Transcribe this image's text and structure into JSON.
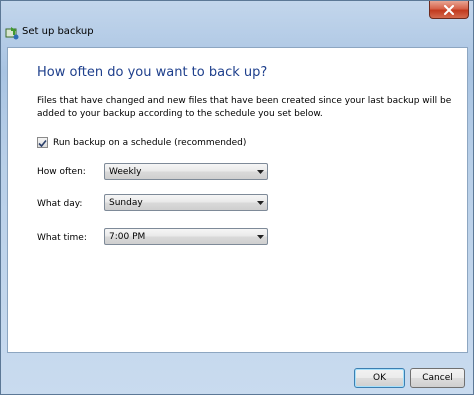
{
  "window": {
    "title": "Set up backup",
    "close_glyph": "✕"
  },
  "main": {
    "heading": "How often do you want to back up?",
    "description": "Files that have changed and new files that have been created since your last backup will be added to your backup according to the schedule you set below.",
    "schedule_checkbox": {
      "label": "Run backup on a schedule (recommended)",
      "checked": true
    },
    "fields": [
      {
        "label": "How often:",
        "value": "Weekly"
      },
      {
        "label": "What day:",
        "value": "Sunday"
      },
      {
        "label": "What time:",
        "value": "7:00 PM"
      }
    ]
  },
  "buttons": {
    "ok": "OK",
    "cancel": "Cancel"
  },
  "colors": {
    "heading": "#1e3f8c",
    "close_button": "#c23a1e"
  },
  "icons": {
    "title_icon": "backup-icon",
    "close": "close-icon",
    "dropdown": "chevron-down-icon",
    "check": "checkmark-icon"
  }
}
